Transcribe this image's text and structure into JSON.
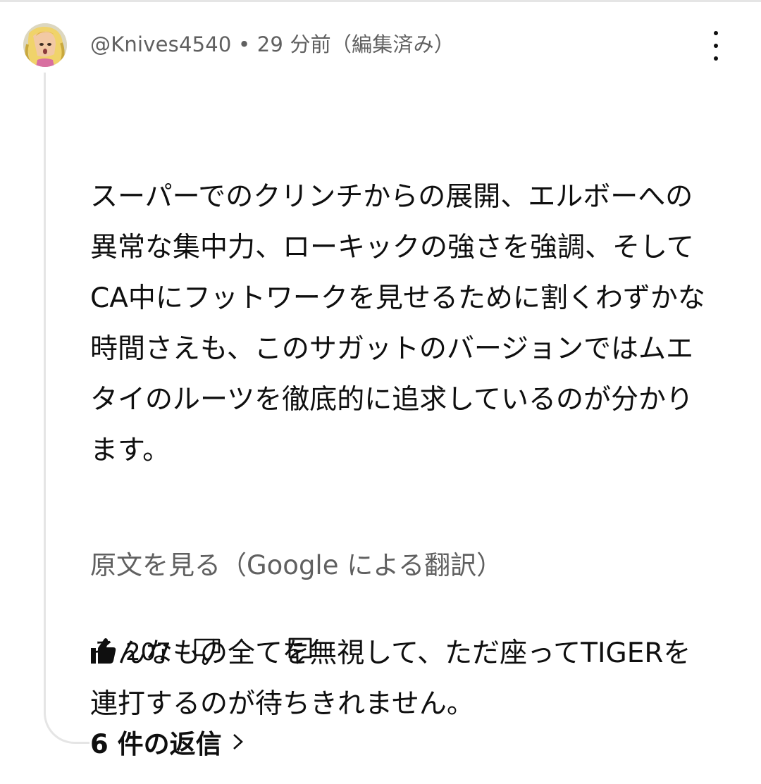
{
  "comment": {
    "author": "@Knives4540",
    "separator": "•",
    "time": "29 分前",
    "edited": "（編集済み）",
    "text": [
      "スーパーでのクリンチからの展開、エルボーへの異常な集中力、ローキックの強さを強調、そしてCA中にフットワークを見せるために割くわずかな時間さえも、このサガットのバージョンではムエタイのルーツを徹底的に追求しているのが分かります。",
      "そんなもの全てを無視して、ただ座ってTIGERを連打するのが待ちきれません。"
    ],
    "translation_link": "原文を見る（Google による翻訳）"
  },
  "actions": {
    "like_icon": "thumbs-up-icon",
    "like_count": "207",
    "dislike_icon": "thumbs-down-icon",
    "reply_icon": "reply-comment-icon"
  },
  "replies": {
    "label": "6 件の返信",
    "icon": "chevron-right-icon"
  },
  "more_icon": "three-dots-vertical-icon"
}
